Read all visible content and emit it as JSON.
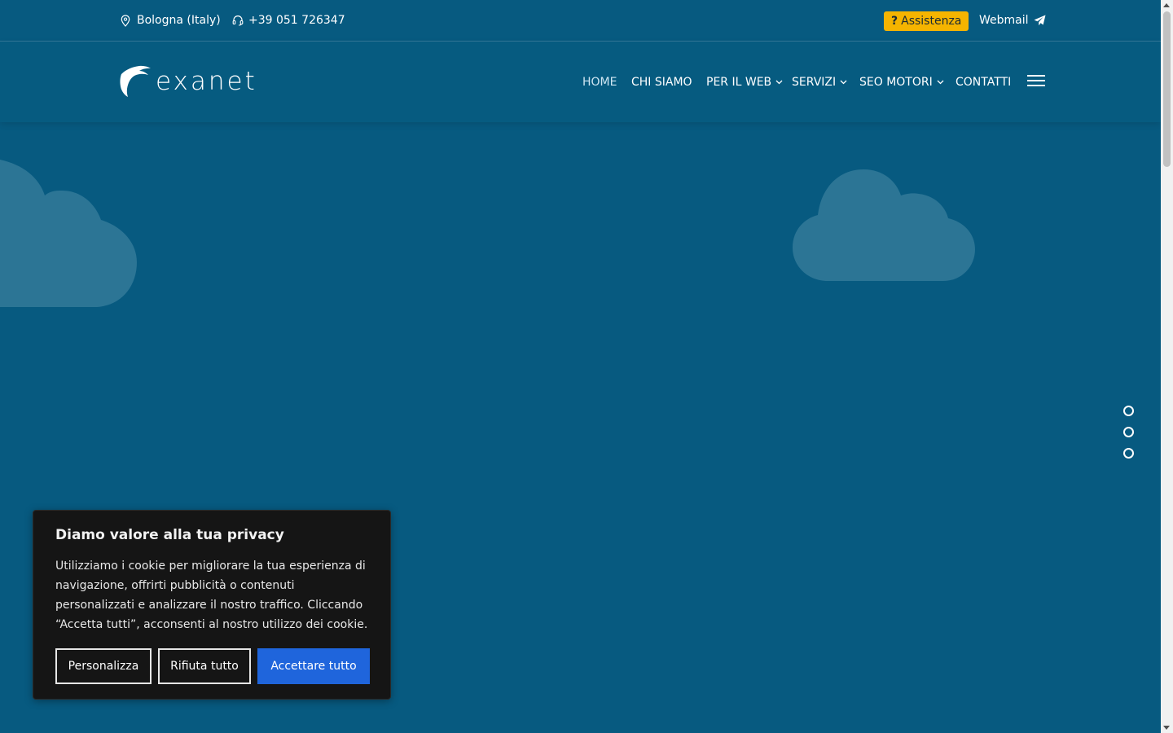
{
  "topbar": {
    "location": "Bologna (Italy)",
    "phone": "+39 051 726347",
    "assist_label": "Assistenza",
    "assist_icon": "question-icon",
    "webmail_label": "Webmail",
    "webmail_icon": "paper-plane-icon"
  },
  "header": {
    "logo_text": "exanet",
    "nav": [
      {
        "label": "HOME",
        "active": true
      },
      {
        "label": "CHI SIAMO"
      },
      {
        "label": "PER IL WEB",
        "dropdown": true
      },
      {
        "label": "SERVIZI",
        "dropdown": true
      },
      {
        "label": "SEO MOTORI",
        "dropdown": true
      },
      {
        "label": "CONTATTI"
      }
    ]
  },
  "slider": {
    "dots": 3
  },
  "cookie": {
    "title": "Diamo valore alla tua privacy",
    "text": "Utilizziamo i cookie per migliorare la tua esperienza di navigazione, offrirti pubblicità o contenuti personalizzati e analizzare il nostro traffico. Cliccando “Accetta tutti”, acconsenti al nostro utilizzo dei cookie.",
    "customize_label": "Personalizza",
    "reject_label": "Rifiuta tutto",
    "accept_label": "Accettare tutto"
  },
  "colors": {
    "background": "#075a80",
    "assist": "#f5b400",
    "accept": "#1f65dc",
    "cookie_bg": "#151515"
  }
}
